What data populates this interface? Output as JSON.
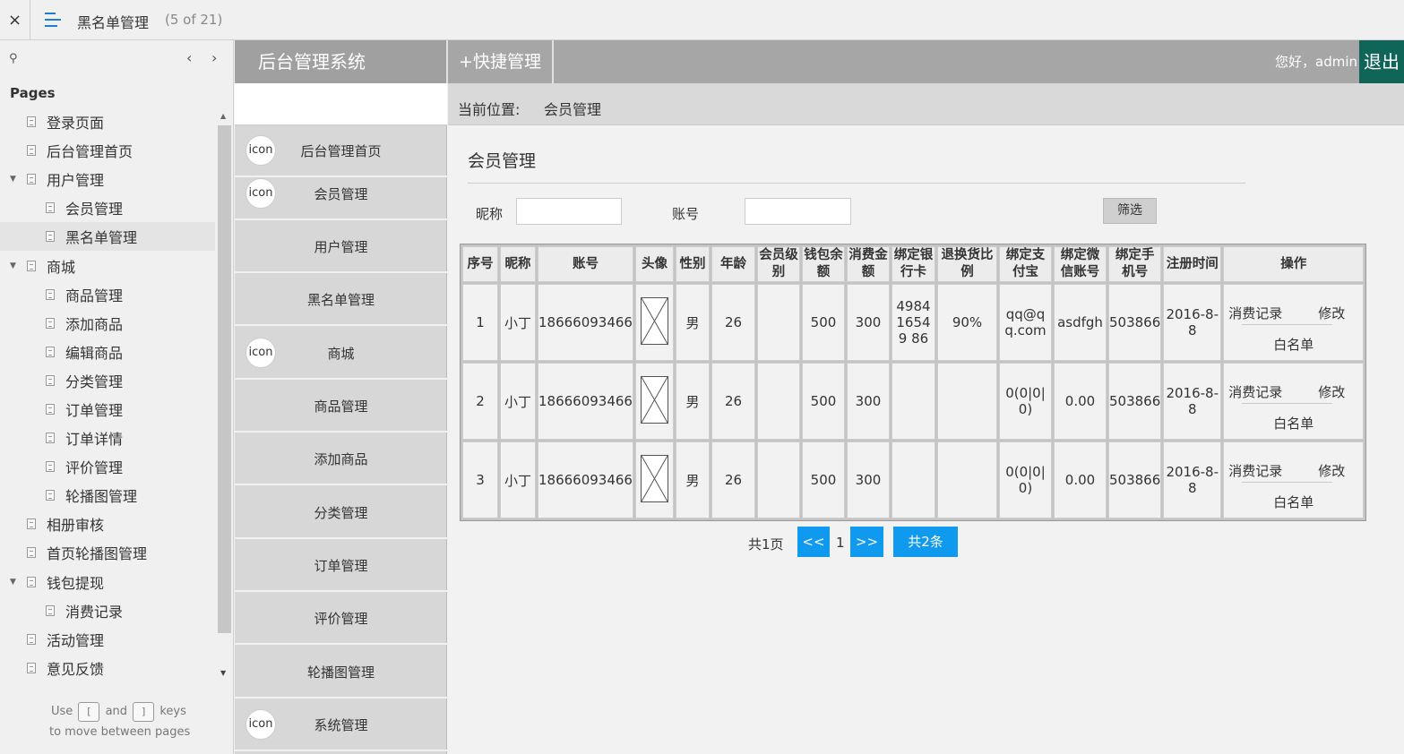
{
  "player": {
    "close_icon": "×",
    "page_title": "黑名单管理",
    "page_count": "(5 of 21)"
  },
  "sitemap": {
    "heading": "Pages",
    "items": [
      {
        "label": "登录页面",
        "level": 0,
        "expander": false
      },
      {
        "label": "后台管理首页",
        "level": 0,
        "expander": false
      },
      {
        "label": "用户管理",
        "level": 0,
        "expander": true
      },
      {
        "label": "会员管理",
        "level": 1,
        "expander": false
      },
      {
        "label": "黑名单管理",
        "level": 1,
        "expander": false,
        "active": true
      },
      {
        "label": "商城",
        "level": 0,
        "expander": true
      },
      {
        "label": "商品管理",
        "level": 1,
        "expander": false
      },
      {
        "label": "添加商品",
        "level": 1,
        "expander": false
      },
      {
        "label": "编辑商品",
        "level": 1,
        "expander": false
      },
      {
        "label": "分类管理",
        "level": 1,
        "expander": false
      },
      {
        "label": "订单管理",
        "level": 1,
        "expander": false
      },
      {
        "label": "订单详情",
        "level": 1,
        "expander": false
      },
      {
        "label": "评价管理",
        "level": 1,
        "expander": false
      },
      {
        "label": "轮播图管理",
        "level": 1,
        "expander": false
      },
      {
        "label": "相册审核",
        "level": 0,
        "expander": false
      },
      {
        "label": "首页轮播图管理",
        "level": 0,
        "expander": false
      },
      {
        "label": "钱包提现",
        "level": 0,
        "expander": true
      },
      {
        "label": "消费记录",
        "level": 1,
        "expander": false
      },
      {
        "label": "活动管理",
        "level": 0,
        "expander": false
      },
      {
        "label": "意见反馈",
        "level": 0,
        "expander": false
      }
    ],
    "help": {
      "use": "Use",
      "and": "and",
      "keys": "keys",
      "line2": "to move between pages",
      "key_prev": "[",
      "key_next": "]"
    }
  },
  "header": {
    "brand": "后台管理系统",
    "quick": "+快捷管理",
    "greeting": "您好，admin",
    "logout": "退出"
  },
  "nav": {
    "icon_text": "icon",
    "items": [
      {
        "label": "后台管理首页",
        "icon": true
      },
      {
        "label": "会员管理",
        "icon": true
      },
      {
        "label": "用户管理",
        "icon": false
      },
      {
        "label": "黑名单管理",
        "icon": false
      },
      {
        "label": "商城",
        "icon": true
      },
      {
        "label": "商品管理",
        "icon": false
      },
      {
        "label": "添加商品",
        "icon": false
      },
      {
        "label": "分类管理",
        "icon": false
      },
      {
        "label": "订单管理",
        "icon": false
      },
      {
        "label": "评价管理",
        "icon": false
      },
      {
        "label": "轮播图管理",
        "icon": false
      },
      {
        "label": "系统管理",
        "icon": true
      }
    ]
  },
  "breadcrumb": {
    "label": "当前位置:",
    "value": "会员管理"
  },
  "section": {
    "title": "会员管理"
  },
  "filter": {
    "nickname_label": "昵称",
    "nickname_value": "",
    "account_label": "账号",
    "account_value": "",
    "button": "筛选"
  },
  "table": {
    "headers": [
      "序号",
      "昵称",
      "账号",
      "头像",
      "性别",
      "年龄",
      "会员级别",
      "钱包余额",
      "消费金额",
      "绑定银行卡",
      "退换货比例",
      "绑定支付宝",
      "绑定微信账号",
      "绑定手机号",
      "注册时间",
      "操作"
    ],
    "rows": [
      {
        "no": "1",
        "nick": "小丁",
        "account": "18666093466",
        "gender": "男",
        "age": "26",
        "level": "",
        "wallet": "500",
        "spent": "300",
        "bank": "498416549 86",
        "return_ratio": "90%",
        "alipay": "qq@qq.com",
        "wechat": "asdfgh",
        "phone": "503866",
        "date": "2016-8-8",
        "op_records": "消费记录",
        "op_edit": "修改",
        "op_white": "白名单"
      },
      {
        "no": "2",
        "nick": "小丁",
        "account": "18666093466",
        "gender": "男",
        "age": "26",
        "level": "",
        "wallet": "500",
        "spent": "300",
        "bank": "",
        "return_ratio": "",
        "alipay": "0(0|0|0)",
        "wechat": "0.00",
        "phone": "503866",
        "date": "2016-8-8",
        "op_records": "消费记录",
        "op_edit": "修改",
        "op_white": "白名单"
      },
      {
        "no": "3",
        "nick": "小丁",
        "account": "18666093466",
        "gender": "男",
        "age": "26",
        "level": "",
        "wallet": "500",
        "spent": "300",
        "bank": "",
        "return_ratio": "",
        "alipay": "0(0|0|0)",
        "wechat": "0.00",
        "phone": "503866",
        "date": "2016-8-8",
        "op_records": "消费记录",
        "op_edit": "修改",
        "op_white": "白名单"
      }
    ]
  },
  "pager": {
    "total_pages": "共1页",
    "prev": "<<",
    "current": "1",
    "next": ">>",
    "total_items": "共2条"
  },
  "colors": {
    "pager_blue": "#0f9af0",
    "logout_green": "#0f6557",
    "menu_blue": "#1e7fd0"
  }
}
